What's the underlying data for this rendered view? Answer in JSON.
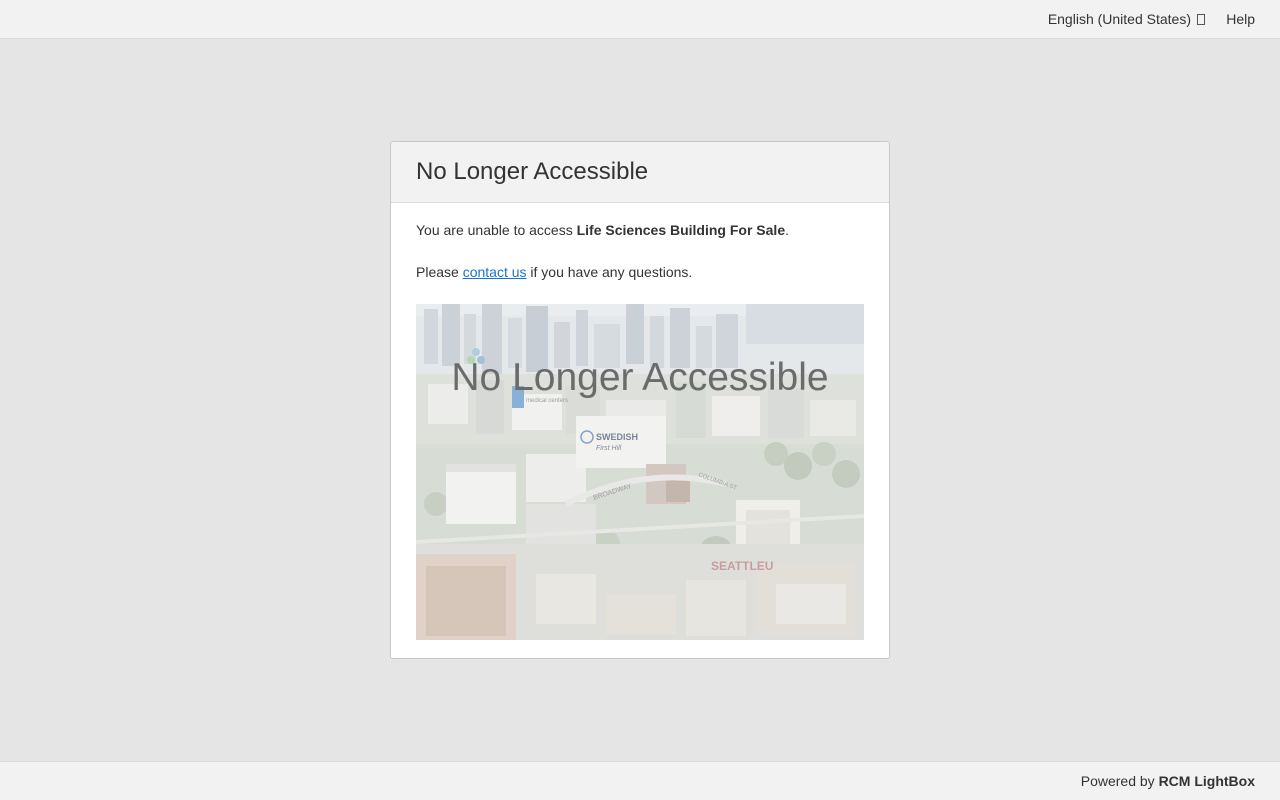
{
  "topbar": {
    "language_label": "English (United States)",
    "help_label": "Help"
  },
  "card": {
    "title": "No Longer Accessible",
    "message_prefix": "You are unable to access ",
    "property_name": "Life Sciences Building For Sale",
    "message_suffix": ".",
    "contact_prefix": "Please ",
    "contact_link": "contact us",
    "contact_suffix": " if you have any questions.",
    "image": {
      "overlay_text": "No Longer Accessible",
      "labels": {
        "medical_centers": "medical centers",
        "swedish": "SWEDISH",
        "first_hill": "First Hill",
        "broadway": "BROADWAY",
        "columbia": "COLUMBIA ST",
        "seattle_u": "SEATTLEU"
      }
    }
  },
  "footer": {
    "powered_prefix": "Powered by ",
    "brand": "RCM LightBox"
  },
  "colors": {
    "link": "#1a73c9",
    "background": "#e5e5e5",
    "bar": "#f2f2f2"
  }
}
